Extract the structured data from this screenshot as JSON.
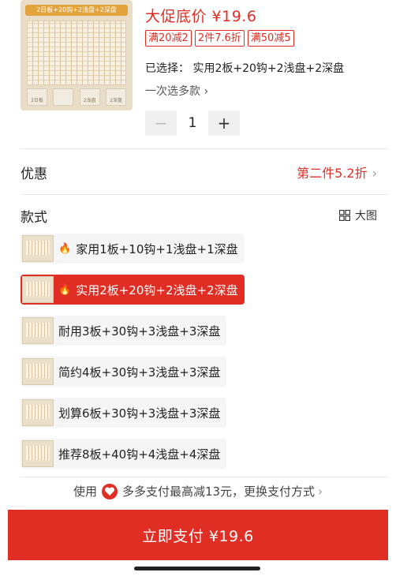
{
  "product": {
    "thumb_banner": "2日板+20钩+2浅盘+2深盘",
    "tray_labels": [
      "2日板",
      "",
      "2浅盘",
      "2深盘"
    ],
    "price": "大促底价 ¥19.6",
    "tags": [
      "满20减2",
      "2件7.6折",
      "满50减5"
    ],
    "selected": "已选择：  实用2板+20钩+2浅盘+2深盘",
    "multi_select": "一次选多款",
    "quantity": "1"
  },
  "discount": {
    "label": "优惠",
    "value": "第二件5.2折"
  },
  "style": {
    "label": "款式",
    "large_view": "大图",
    "options": [
      {
        "label": "家用1板+10钩+1浅盘+1深盘",
        "hot": true,
        "selected": false
      },
      {
        "label": "实用2板+20钩+2浅盘+2深盘",
        "hot": true,
        "selected": true
      },
      {
        "label": "耐用3板+30钩+3浅盘+3深盘",
        "hot": false,
        "selected": false
      },
      {
        "label": "简约4板+30钩+3浅盘+3深盘",
        "hot": false,
        "selected": false
      },
      {
        "label": "划算6板+30钩+3浅盘+3深盘",
        "hot": false,
        "selected": false
      },
      {
        "label": "推荐8板+40钩+4浅盘+4深盘",
        "hot": false,
        "selected": false
      }
    ]
  },
  "payment": {
    "hint_prefix": "使用",
    "hint_text": "多多支付最高减13元，更换支付方式",
    "pay_button": "立即支付 ¥19.6"
  },
  "colors": {
    "accent": "#e02e24"
  }
}
